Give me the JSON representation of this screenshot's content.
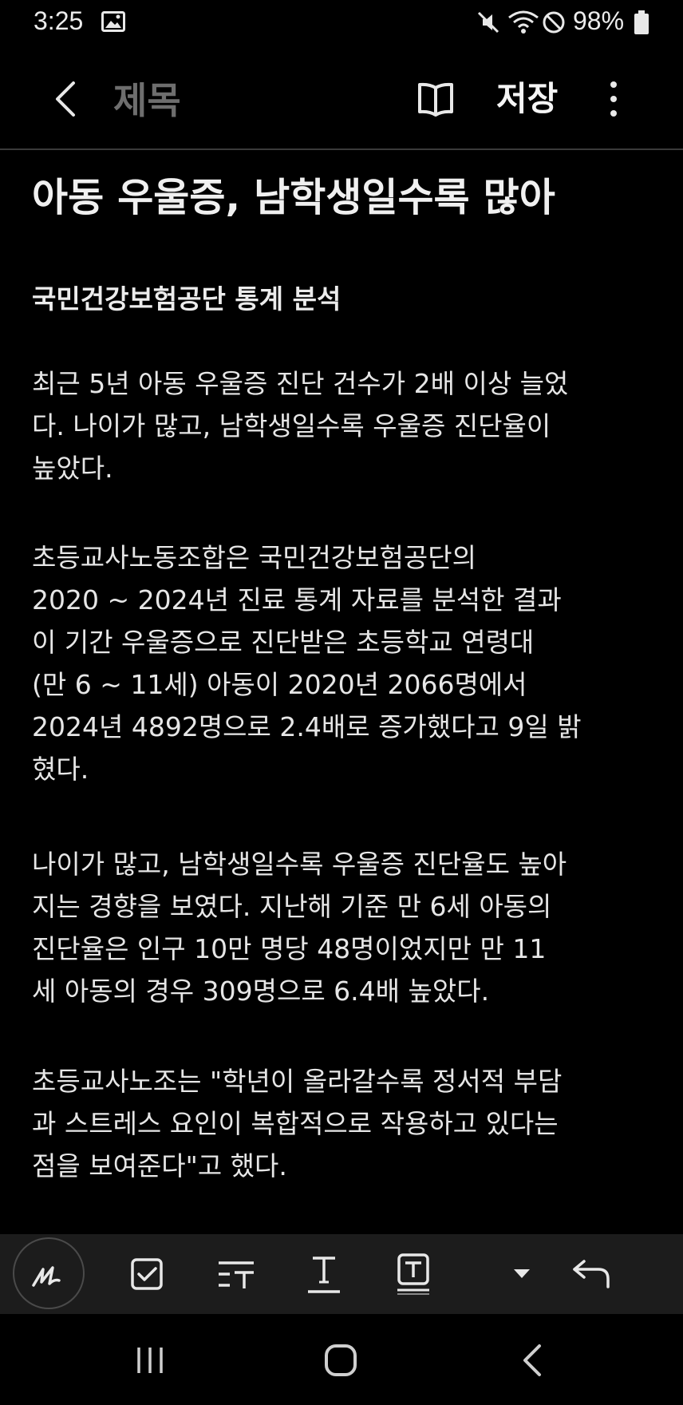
{
  "status_bar": {
    "time": "3:25",
    "battery": "98%",
    "icons": [
      "image-icon",
      "mute-icon",
      "wifi-icon",
      "block-icon",
      "battery-icon"
    ]
  },
  "header": {
    "title_placeholder": "제목",
    "save_label": "저장",
    "icons": [
      "back-icon",
      "reader-mode-icon",
      "more-options-icon"
    ]
  },
  "note": {
    "heading": "아동 우울증, 남학생일수록 많아",
    "subheading": "국민건강보험공단 통계 분석",
    "paragraphs": [
      "최근 5년 아동 우울증 진단 건수가 2배 이상 늘었\n다. 나이가 많고, 남학생일수록 우울증 진단율이\n높았다.",
      "초등교사노동조합은 국민건강보험공단의\n2020 ~ 2024년 진료 통계 자료를 분석한 결과\n이 기간 우울증으로 진단받은 초등학교 연령대\n(만 6 ~ 11세) 아동이 2020년 2066명에서\n2024년 4892명으로 2.4배로 증가했다고 9일 밝\n혔다.",
      "나이가 많고, 남학생일수록 우울증 진단율도 높아\n지는 경향을 보였다. 지난해 기준 만 6세 아동의\n진단율은 인구 10만 명당 48명이었지만 만 11\n세 아동의 경우 309명으로 6.4배 높았다.",
      "초등교사노조는 \"학년이 올라갈수록 정서적 부담\n과 스트레스 요인이 복합적으로 작용하고 있다는\n점을 보여준다\"고 했다."
    ]
  },
  "toolbar": {
    "items": [
      "pen-icon",
      "checkbox-icon",
      "text-style-icon",
      "text-format-icon",
      "text-box-icon",
      "dropdown-arrow-icon",
      "undo-icon"
    ]
  },
  "nav_bar": {
    "items": [
      "recent-apps-icon",
      "home-icon",
      "back-nav-icon"
    ]
  },
  "colors": {
    "background": "#000000",
    "toolbar_background": "#1c1c1c",
    "text": "#e6e6e6",
    "placeholder": "#6e6e6e",
    "divider": "#3a3a3a"
  }
}
